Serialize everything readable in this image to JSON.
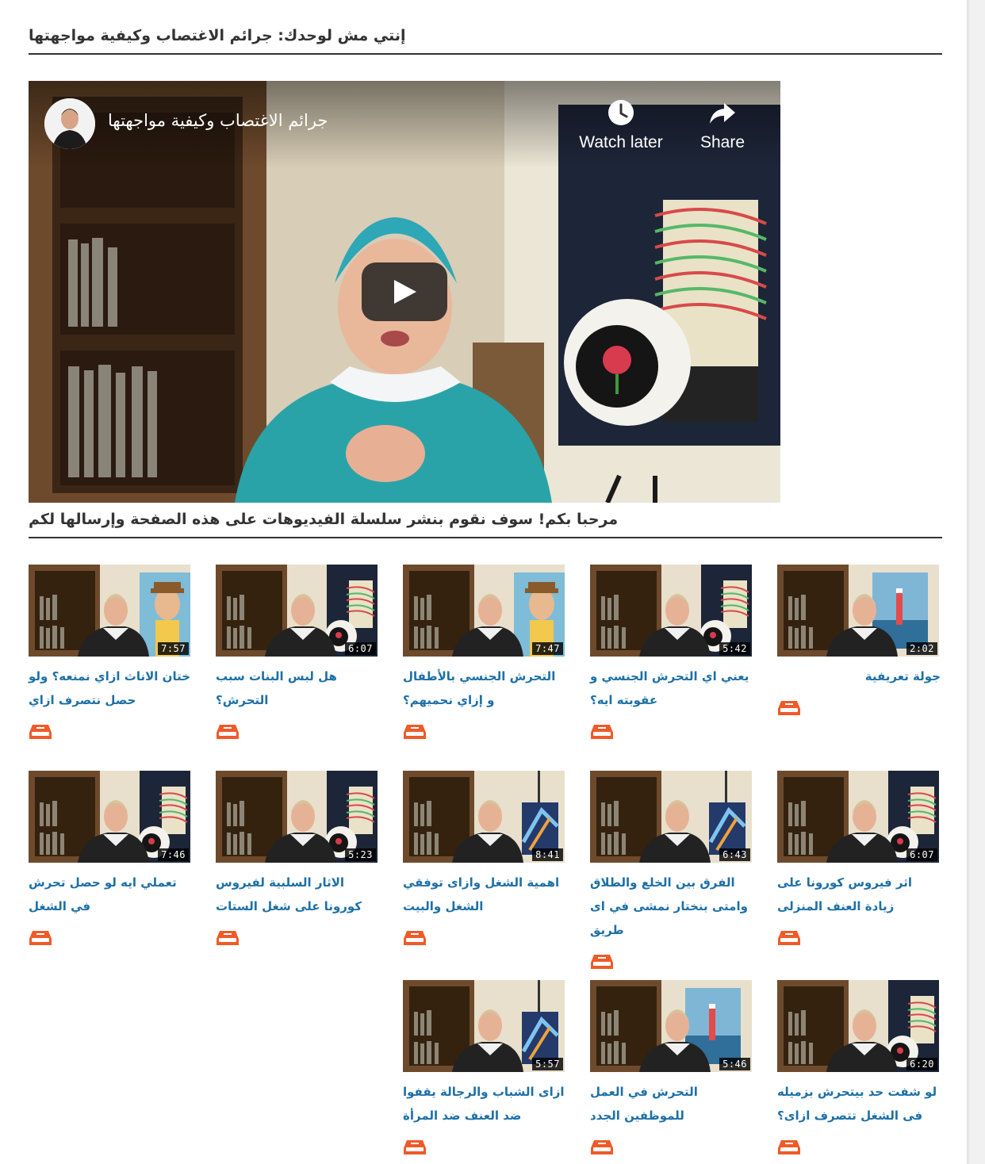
{
  "page": {
    "heading": "إنتي مش لوحدك: جرائم الاغتصاب وكيفية مواجهتها",
    "intro": "مرحبا بكم! سوف نقوم بنشر سلسلة الفيديوهات على هذه الصفحة وإرسالها لكم"
  },
  "player": {
    "title": "جرائم الاغتصاب وكيفية مواجهتها",
    "watch_later_label": "Watch later",
    "share_label": "Share",
    "icons": {
      "watch_later": "clock-icon",
      "share": "share-arrow-icon",
      "play": "play-icon"
    }
  },
  "colors": {
    "link": "#1e70a6",
    "icon_accent": "#f05a28",
    "rule": "#333333"
  },
  "videos": [
    {
      "title": "جولة تعريفية",
      "duration": "2:02",
      "art": "lighthouse"
    },
    {
      "title": "يعني اي التحرش الجنسي و عقوبته ايه؟",
      "duration": "5:42",
      "art": "girl"
    },
    {
      "title": "التحرش الجنسي بالأطفال و إزاي نحميهم؟",
      "duration": "7:47",
      "art": "woody"
    },
    {
      "title": "هل لبس البنات سبب التحرش؟",
      "duration": "6:07",
      "art": "girl"
    },
    {
      "title": "ختان الاناث ازاي نمنعه؟ ولو حصل نتصرف ازاي",
      "duration": "7:57",
      "art": "woody"
    },
    {
      "title": "اثر فيروس كورونا على زيادة العنف المنزلى",
      "duration": "6:07",
      "art": "girl"
    },
    {
      "title": "الفرق بين الخلع والطلاق وامتى بنختار نمشى في اى طريق",
      "duration": "6:43",
      "art": "abstract"
    },
    {
      "title": "اهمية الشغل وازاى توفقي الشغل والبيت",
      "duration": "8:41",
      "art": "abstract"
    },
    {
      "title": "الاثار السلبية لفيروس كورونا على شغل الستات",
      "duration": "5:23",
      "art": "girl"
    },
    {
      "title": "تعملي ايه لو حصل تحرش في الشغل",
      "duration": "7:46",
      "art": "girl"
    },
    {
      "title": "لو شفت حد بيتحرش بزميله فى الشغل تتصرف ازاى؟",
      "duration": "6:20",
      "art": "girl"
    },
    {
      "title": "التحرش في العمل للموظفين الجدد",
      "duration": "5:46",
      "art": "lighthouse"
    },
    {
      "title": "ازاى الشباب والرجالة يقفوا ضد العنف ضد المرأة",
      "duration": "5:57",
      "art": "abstract"
    }
  ]
}
